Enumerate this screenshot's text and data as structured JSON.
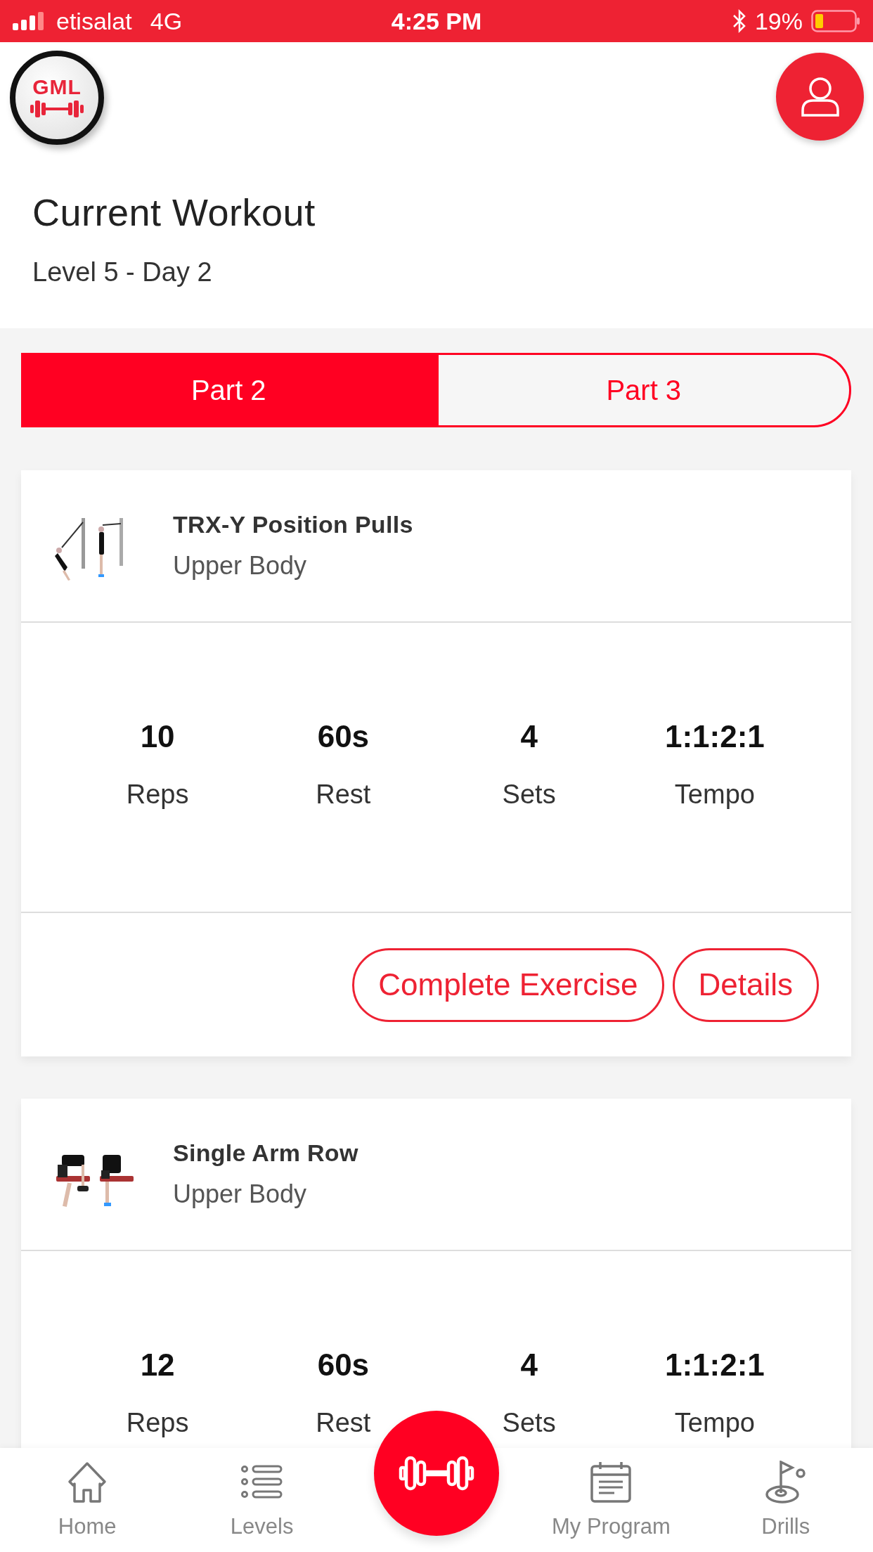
{
  "status_bar": {
    "carrier": "etisalat",
    "network": "4G",
    "time": "4:25 PM",
    "battery": "19%"
  },
  "header": {
    "logo_text": "GML",
    "title": "Current Workout",
    "subtitle": "Level 5 - Day 2"
  },
  "parts": [
    {
      "label": "Part 2",
      "selected": true
    },
    {
      "label": "Part 3",
      "selected": false
    }
  ],
  "exercises": [
    {
      "thumbnail": {
        "kind": "picture"
      },
      "name": "TRX-Y Position Pulls",
      "category": "Upper Body",
      "stats": [
        {
          "value": "10",
          "label": "Reps"
        },
        {
          "value": "60s",
          "label": "Rest"
        },
        {
          "value": "4",
          "label": "Sets"
        },
        {
          "value": "1:1:2:1",
          "label": "Tempo"
        }
      ],
      "actions": [
        "Complete Exercise",
        "Details"
      ]
    },
    {
      "thumbnail": {
        "kind": "picture"
      },
      "name": "Single Arm Row",
      "category": "Upper Body",
      "stats": [
        {
          "value": "12",
          "label": "Reps"
        },
        {
          "value": "60s",
          "label": "Rest"
        },
        {
          "value": "4",
          "label": "Sets"
        },
        {
          "value": "1:1:2:1",
          "label": "Tempo"
        }
      ]
    }
  ],
  "bottom_nav": [
    {
      "kind": "tab",
      "label": "Home"
    },
    {
      "kind": "tab",
      "label": "Levels"
    },
    {
      "kind": "fab"
    },
    {
      "kind": "tab",
      "label": "My Program"
    },
    {
      "kind": "tab",
      "label": "Drills"
    }
  ]
}
